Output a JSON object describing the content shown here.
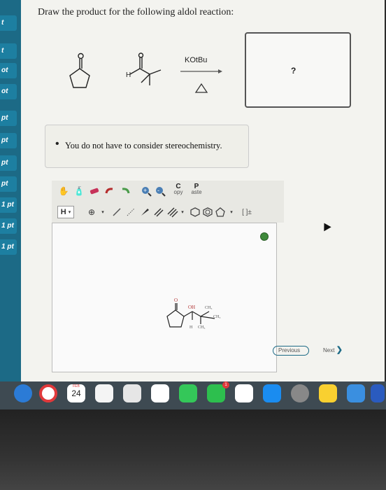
{
  "sidebar": {
    "items": [
      "t",
      "ot",
      "ot",
      "pt",
      "pt",
      "pt",
      "pt",
      "1 pt",
      "1 pt",
      "1 pt"
    ]
  },
  "question": {
    "text": "Draw the product for the following aldol reaction:",
    "reagent": "KOtBu",
    "reagent_heat": "Δ",
    "answer_placeholder": "?"
  },
  "note": {
    "bullet": "•",
    "text": "You do not have to consider stereochemistry."
  },
  "toolbar": {
    "copy_label_c": "C",
    "copy_label": "opy",
    "paste_label_p": "P",
    "paste_label": "aste",
    "h_label": "H",
    "bracket_label": "[ ]±"
  },
  "canvas_drawing": {
    "oh": "OH",
    "ch3_top": "CH₃",
    "ch3_right": "CH₃",
    "h": "H",
    "ch3_bottom": "CH₃",
    "o": "O"
  },
  "nav": {
    "previous": "Previous",
    "next": "Next"
  },
  "dock": {
    "calendar_month": "FEB",
    "calendar_day": "24",
    "notification_count": "1"
  }
}
